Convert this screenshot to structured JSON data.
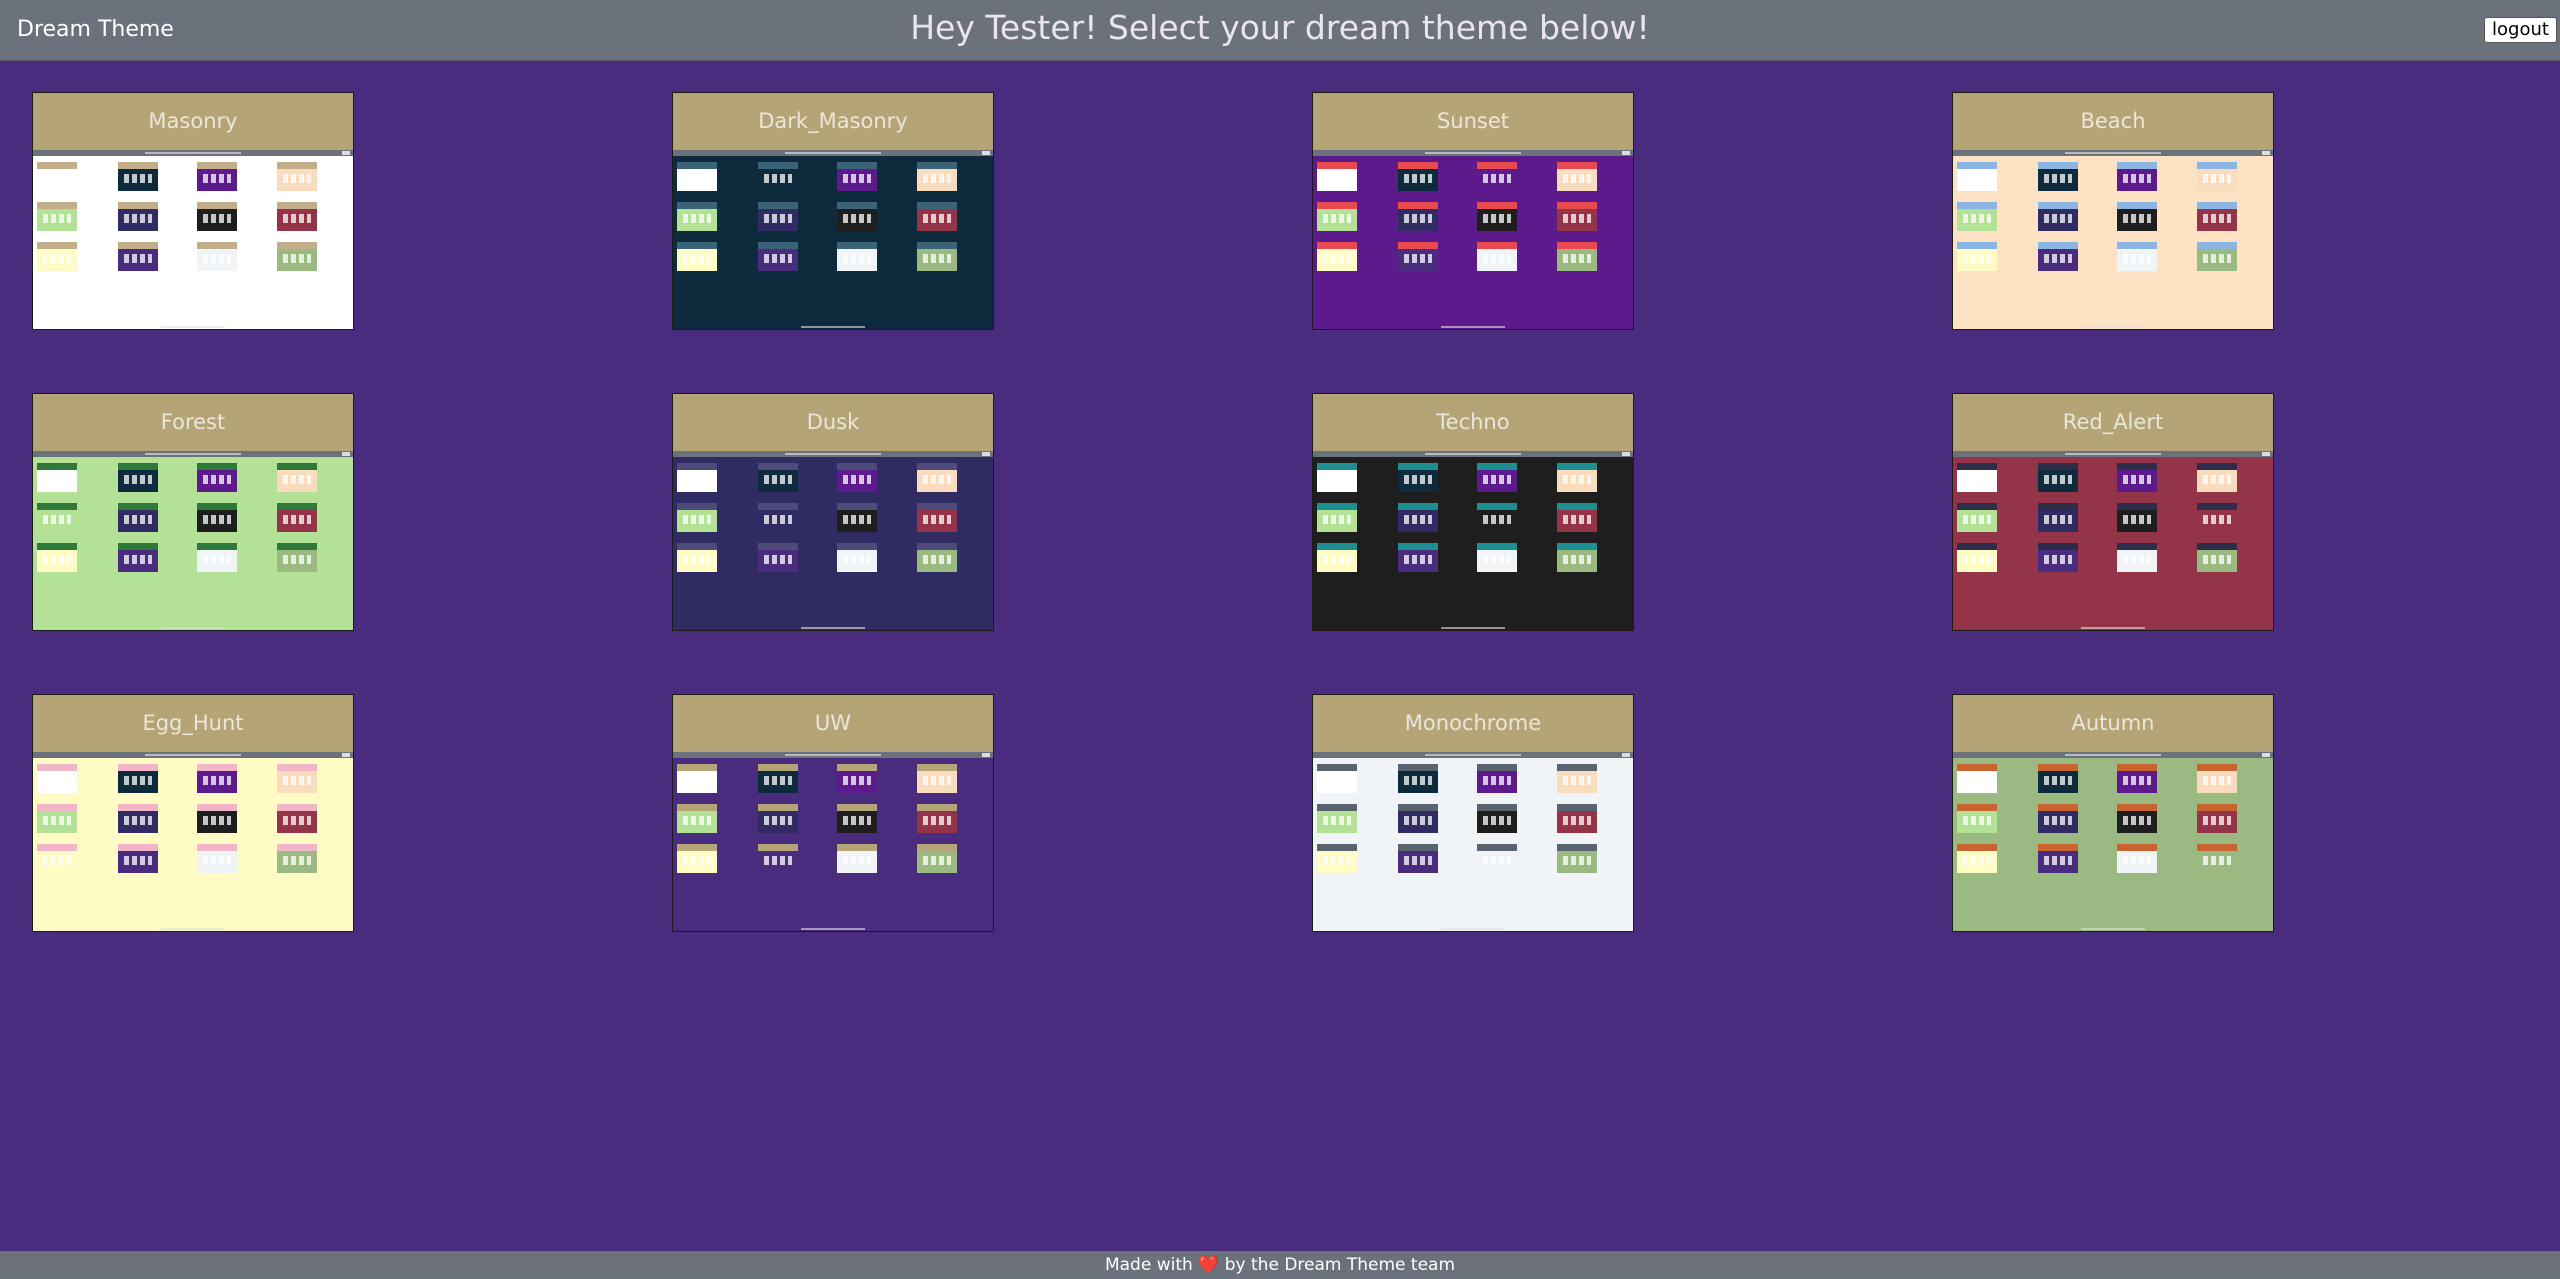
{
  "header": {
    "brand": "Dream Theme",
    "headline": "Hey Tester! Select your dream theme below!",
    "logout_label": "logout",
    "bar_color": "#6b727c"
  },
  "page": {
    "background": "#4a2c7e"
  },
  "mini_backgrounds": [
    "#ffffff",
    "#0e2a3d",
    "#5c1a8d",
    "#f9dcbd",
    "#b3e196",
    "#312b63",
    "#1e1e1e",
    "#933448",
    "#fefcc4",
    "#4a2c7e",
    "#f0f4f7",
    "#9aba81"
  ],
  "themes": [
    {
      "label": "Masonry",
      "bg": "#ffffff",
      "header": "#c2ae8a"
    },
    {
      "label": "Dark_Masonry",
      "bg": "#0e2a3d",
      "header": "#3b6478"
    },
    {
      "label": "Sunset",
      "bg": "#5c1a8d",
      "header": "#e94a4f"
    },
    {
      "label": "Beach",
      "bg": "#fde2c4",
      "header": "#8bb6e3"
    },
    {
      "label": "Forest",
      "bg": "#b3e196",
      "header": "#2f7a3a"
    },
    {
      "label": "Dusk",
      "bg": "#312b63",
      "header": "#4e4a7a"
    },
    {
      "label": "Techno",
      "bg": "#1e1e1e",
      "header": "#1e8f91"
    },
    {
      "label": "Red_Alert",
      "bg": "#933448",
      "header": "#2d2d4a"
    },
    {
      "label": "Egg_Hunt",
      "bg": "#fefcc4",
      "header": "#f3b6c8"
    },
    {
      "label": "UW",
      "bg": "#4a2c7e",
      "header": "#b5a576"
    },
    {
      "label": "Monochrome",
      "bg": "#f0f4f7",
      "header": "#5a6470"
    },
    {
      "label": "Autumn",
      "bg": "#9aba81",
      "header": "#c9632f"
    }
  ],
  "footer": {
    "before": "Made with",
    "heart": "❤️",
    "after": "by the Dream Theme team"
  }
}
